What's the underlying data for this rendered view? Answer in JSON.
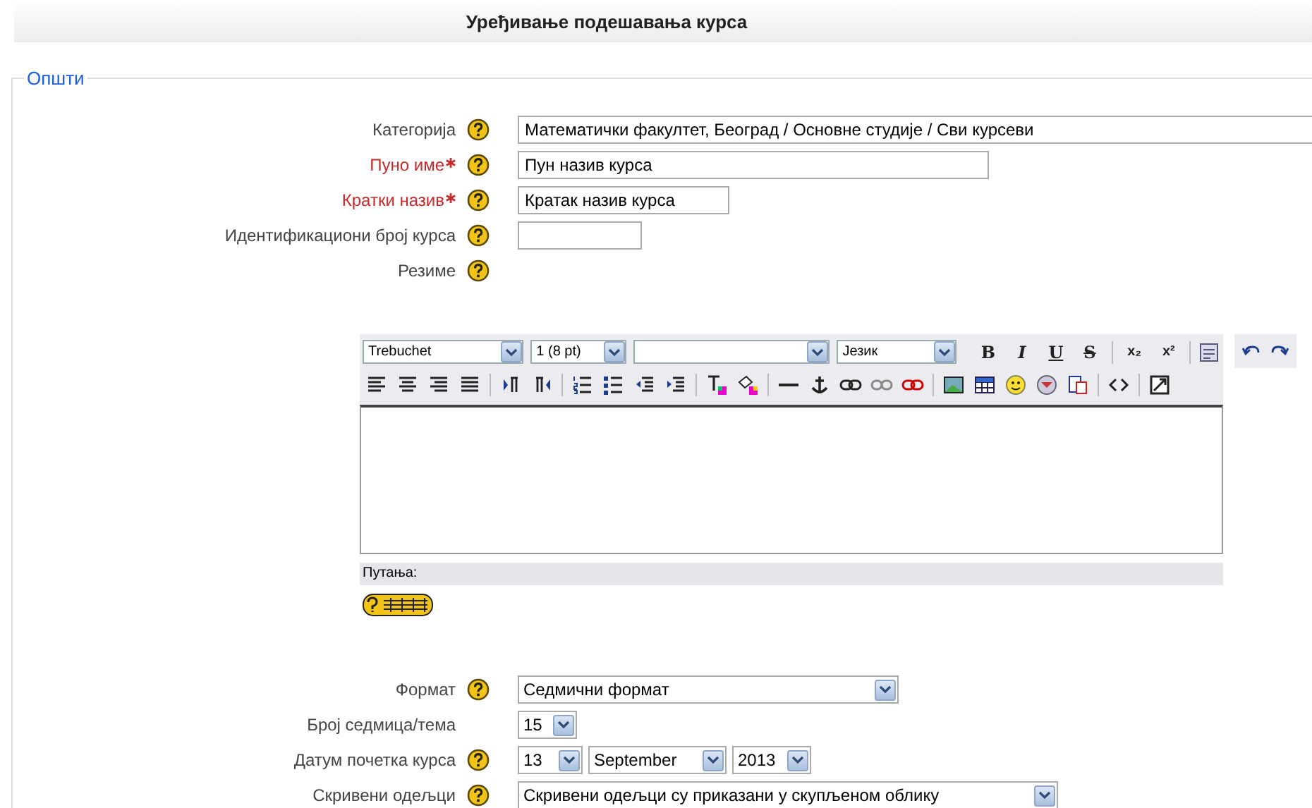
{
  "page_title": "Уређивање подешавања курса",
  "section": {
    "legend": "Општи"
  },
  "fields": [
    {
      "label": "Категорија",
      "required": false,
      "help": true,
      "kind": "text",
      "value": "Математички факултет, Београд / Основне студије / Сви курсеви"
    },
    {
      "label": "Пуно име",
      "required": true,
      "help": true,
      "kind": "text",
      "value": "Пун назив курса"
    },
    {
      "label": "Кратки назив",
      "required": true,
      "help": true,
      "kind": "text",
      "value": "Кратак назив курса"
    },
    {
      "label": "Идентификациони број курса",
      "required": false,
      "help": true,
      "kind": "text"
    },
    {
      "label": "Резиме",
      "required": false,
      "help": true,
      "kind": "editor"
    },
    {
      "label": "Формат",
      "required": false,
      "help": true,
      "kind": "selects",
      "options": [
        "Седмични формат"
      ]
    },
    {
      "label": "Број седмица/тема",
      "required": false,
      "help": false,
      "kind": "selects",
      "options": [
        "15"
      ]
    },
    {
      "label": "Датум почетка курса",
      "required": false,
      "help": true,
      "kind": "selects",
      "options": [
        "13",
        "September",
        "2013"
      ]
    },
    {
      "label": "Скривени одељци",
      "required": false,
      "help": true,
      "kind": "selects",
      "options": [
        "Скривени одељци су приказани у скупљеном облику"
      ]
    }
  ],
  "editor": {
    "toolbar_selects": [
      {
        "kind": "filled",
        "value": "Trebuchet"
      },
      {
        "kind": "filled",
        "value": "1 (8 pt)"
      },
      {
        "kind": "blank"
      },
      {
        "kind": "filled",
        "value": "Језик"
      }
    ],
    "format_buttons": [
      "B",
      "I",
      "U",
      "S"
    ],
    "script_buttons": [
      "x₂",
      "x²"
    ],
    "path_label": "Путања:"
  }
}
